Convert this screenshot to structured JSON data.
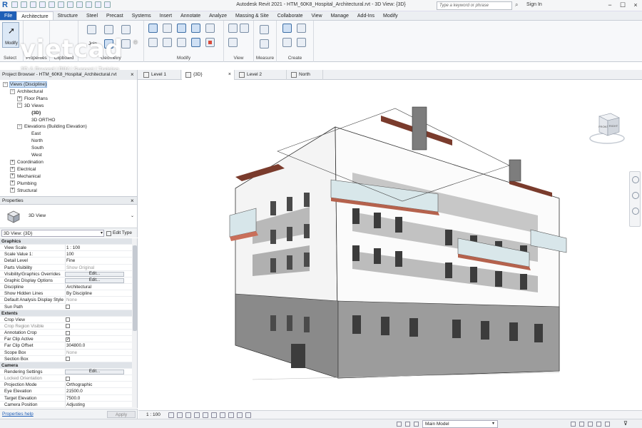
{
  "window": {
    "title": "Autodesk Revit 2021 - HTM_60K8_Hospital_Architectural.rvt - 3D View: {3D}",
    "search_placeholder": "Type a keyword or phrase",
    "sign_in": "Sign In"
  },
  "ribbon": {
    "tabs": [
      "File",
      "Architecture",
      "Structure",
      "Steel",
      "Precast",
      "Systems",
      "Insert",
      "Annotate",
      "Analyze",
      "Massing & Site",
      "Collaborate",
      "View",
      "Manage",
      "Add-Ins",
      "Modify"
    ],
    "active_tab": "Architecture",
    "modify_button": "Modify",
    "panels": {
      "select": "Select",
      "properties": "Properties",
      "clipboard": "Clipboard",
      "join": "Join",
      "geometry": "Geometry",
      "modify": "Modify",
      "view": "View",
      "measure": "Measure",
      "create": "Create"
    }
  },
  "watermark": {
    "name": "vietcad",
    "registered": "®",
    "tagline": "3D & Beyond | BIM | Support | Training"
  },
  "project_browser": {
    "title": "Project Browser - HTM_60K8_Hospital_Architectural.rvt",
    "close": "×",
    "tree": [
      {
        "label": "Views (Discipline)",
        "level": 0,
        "toggle": "−",
        "selected": true
      },
      {
        "label": "Architectural",
        "level": 1,
        "toggle": "−"
      },
      {
        "label": "Floor Plans",
        "level": 2,
        "toggle": "+"
      },
      {
        "label": "3D Views",
        "level": 2,
        "toggle": "−"
      },
      {
        "label": "{3D}",
        "level": 3,
        "toggle": "",
        "bold": true
      },
      {
        "label": "3D ORTHO",
        "level": 3,
        "toggle": ""
      },
      {
        "label": "Elevations (Building Elevation)",
        "level": 2,
        "toggle": "−"
      },
      {
        "label": "East",
        "level": 3,
        "toggle": ""
      },
      {
        "label": "North",
        "level": 3,
        "toggle": ""
      },
      {
        "label": "South",
        "level": 3,
        "toggle": ""
      },
      {
        "label": "West",
        "level": 3,
        "toggle": ""
      },
      {
        "label": "Coordination",
        "level": 1,
        "toggle": "+"
      },
      {
        "label": "Electrical",
        "level": 1,
        "toggle": "+"
      },
      {
        "label": "Mechanical",
        "level": 1,
        "toggle": "+"
      },
      {
        "label": "Plumbing",
        "level": 1,
        "toggle": "+"
      },
      {
        "label": "Structural",
        "level": 1,
        "toggle": "+"
      }
    ]
  },
  "view_tabs": [
    {
      "label": "Level 1",
      "active": false
    },
    {
      "label": "{3D}",
      "active": true
    },
    {
      "label": "Level 2",
      "active": false
    },
    {
      "label": "North",
      "active": false
    }
  ],
  "properties": {
    "title": "Properties",
    "close": "×",
    "type_name": "3D View",
    "instance_selector": "3D View: {3D}",
    "edit_type": "Edit Type",
    "rows": [
      {
        "kind": "group",
        "name": "Graphics"
      },
      {
        "name": "View Scale",
        "value": "1 : 100"
      },
      {
        "name": "Scale Value    1:",
        "value": "100"
      },
      {
        "name": "Detail Level",
        "value": "Fine"
      },
      {
        "name": "Parts Visibility",
        "value": "Show Original",
        "dim_value": true
      },
      {
        "name": "Visibility/Graphics Overrides",
        "button": "Edit..."
      },
      {
        "name": "Graphic Display Options",
        "button": "Edit..."
      },
      {
        "name": "Discipline",
        "value": "Architectural"
      },
      {
        "name": "Show Hidden Lines",
        "value": "By Discipline"
      },
      {
        "name": "Default Analysis Display Style",
        "value": "None",
        "dim_value": true
      },
      {
        "name": "Sun Path",
        "check": false
      },
      {
        "kind": "group",
        "name": "Extents"
      },
      {
        "name": "Crop View",
        "check": false
      },
      {
        "name": "Crop Region Visible",
        "check": false,
        "dim_name": true
      },
      {
        "name": "Annotation Crop",
        "check": false
      },
      {
        "name": "Far Clip Active",
        "check": true
      },
      {
        "name": "Far Clip Offset",
        "value": "304800.0"
      },
      {
        "name": "Scope Box",
        "value": "None",
        "dim_value": true
      },
      {
        "name": "Section Box",
        "check": false
      },
      {
        "kind": "group",
        "name": "Camera"
      },
      {
        "name": "Rendering Settings",
        "button": "Edit..."
      },
      {
        "name": "Locked Orientation",
        "check": false,
        "dim_name": true
      },
      {
        "name": "Projection Mode",
        "value": "Orthographic"
      },
      {
        "name": "Eye Elevation",
        "value": "21500.0"
      },
      {
        "name": "Target Elevation",
        "value": "7500.0"
      },
      {
        "name": "Camera Position",
        "value": "Adjusting"
      }
    ],
    "help_link": "Properties help",
    "apply_button": "Apply"
  },
  "viewcube": {
    "front": "FRONT",
    "right": "RIGHT"
  },
  "view_control": {
    "scale": "1 : 100"
  },
  "status": {
    "model": "Main Model"
  }
}
